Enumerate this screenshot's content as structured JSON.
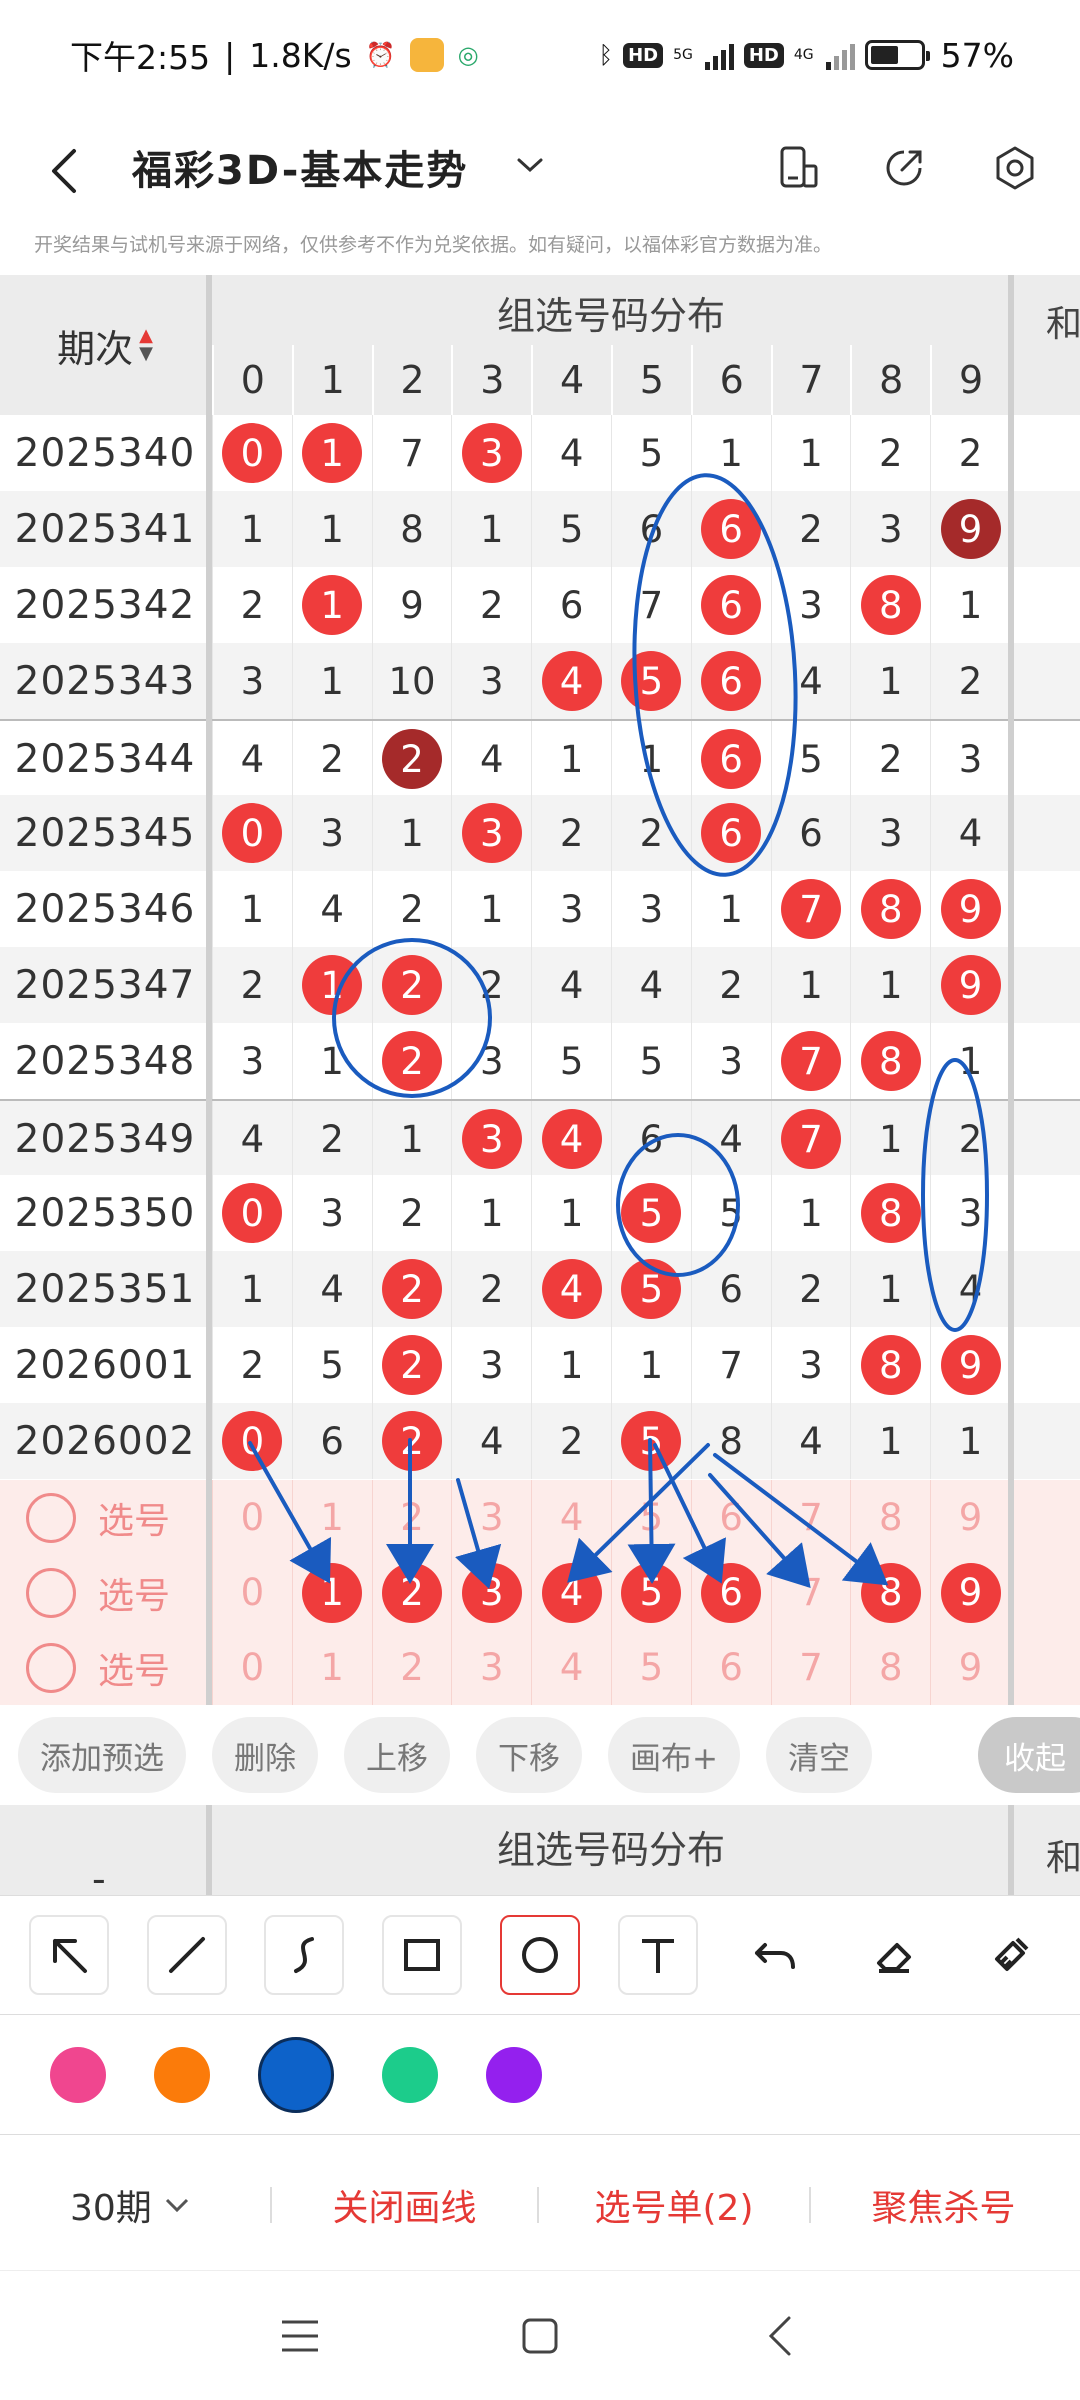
{
  "status": {
    "time": "下午2:55",
    "speed": "1.8K/s",
    "net1": "5G",
    "net2": "4G",
    "hd": "HD",
    "battery": "57%",
    "battery_level": 0.57
  },
  "header": {
    "title": "福彩3D-基本走势"
  },
  "notice": "开奖结果与试机号来源于网络，仅供参考不作为兑奖依据。如有疑问，以福体彩官方数据为准。",
  "table": {
    "period_header": "期次",
    "group_title": "组选号码分布",
    "sum_header": "和",
    "digits": [
      "0",
      "1",
      "2",
      "3",
      "4",
      "5",
      "6",
      "7",
      "8",
      "9"
    ],
    "rows": [
      {
        "period": "2025340",
        "cells": [
          {
            "v": "0",
            "b": "r"
          },
          {
            "v": "1",
            "b": "r"
          },
          {
            "v": "7"
          },
          {
            "v": "3",
            "b": "r"
          },
          {
            "v": "4"
          },
          {
            "v": "5"
          },
          {
            "v": "1"
          },
          {
            "v": "1"
          },
          {
            "v": "2"
          },
          {
            "v": "2"
          }
        ]
      },
      {
        "period": "2025341",
        "cells": [
          {
            "v": "1"
          },
          {
            "v": "1"
          },
          {
            "v": "8"
          },
          {
            "v": "1"
          },
          {
            "v": "5"
          },
          {
            "v": "6"
          },
          {
            "v": "6",
            "b": "r"
          },
          {
            "v": "2"
          },
          {
            "v": "3"
          },
          {
            "v": "9",
            "b": "d"
          }
        ]
      },
      {
        "period": "2025342",
        "cells": [
          {
            "v": "2"
          },
          {
            "v": "1",
            "b": "r"
          },
          {
            "v": "9"
          },
          {
            "v": "2"
          },
          {
            "v": "6"
          },
          {
            "v": "7"
          },
          {
            "v": "6",
            "b": "r"
          },
          {
            "v": "3"
          },
          {
            "v": "8",
            "b": "r"
          },
          {
            "v": "1"
          }
        ]
      },
      {
        "period": "2025343",
        "cells": [
          {
            "v": "3"
          },
          {
            "v": "1"
          },
          {
            "v": "10"
          },
          {
            "v": "3"
          },
          {
            "v": "4",
            "b": "r"
          },
          {
            "v": "5",
            "b": "r"
          },
          {
            "v": "6",
            "b": "r"
          },
          {
            "v": "4"
          },
          {
            "v": "1"
          },
          {
            "v": "2"
          }
        ]
      },
      {
        "period": "2025344",
        "cells": [
          {
            "v": "4"
          },
          {
            "v": "2"
          },
          {
            "v": "2",
            "b": "d"
          },
          {
            "v": "4"
          },
          {
            "v": "1"
          },
          {
            "v": "1"
          },
          {
            "v": "6",
            "b": "r"
          },
          {
            "v": "5"
          },
          {
            "v": "2"
          },
          {
            "v": "3"
          }
        ]
      },
      {
        "period": "2025345",
        "cells": [
          {
            "v": "0",
            "b": "r"
          },
          {
            "v": "3"
          },
          {
            "v": "1"
          },
          {
            "v": "3",
            "b": "r"
          },
          {
            "v": "2"
          },
          {
            "v": "2"
          },
          {
            "v": "6",
            "b": "r"
          },
          {
            "v": "6"
          },
          {
            "v": "3"
          },
          {
            "v": "4"
          }
        ]
      },
      {
        "period": "2025346",
        "cells": [
          {
            "v": "1"
          },
          {
            "v": "4"
          },
          {
            "v": "2"
          },
          {
            "v": "1"
          },
          {
            "v": "3"
          },
          {
            "v": "3"
          },
          {
            "v": "1"
          },
          {
            "v": "7",
            "b": "r"
          },
          {
            "v": "8",
            "b": "r"
          },
          {
            "v": "9",
            "b": "r"
          }
        ]
      },
      {
        "period": "2025347",
        "cells": [
          {
            "v": "2"
          },
          {
            "v": "1",
            "b": "r"
          },
          {
            "v": "2",
            "b": "r"
          },
          {
            "v": "2"
          },
          {
            "v": "4"
          },
          {
            "v": "4"
          },
          {
            "v": "2"
          },
          {
            "v": "1"
          },
          {
            "v": "1"
          },
          {
            "v": "9",
            "b": "r"
          }
        ]
      },
      {
        "period": "2025348",
        "cells": [
          {
            "v": "3"
          },
          {
            "v": "1"
          },
          {
            "v": "2",
            "b": "r"
          },
          {
            "v": "3"
          },
          {
            "v": "5"
          },
          {
            "v": "5"
          },
          {
            "v": "3"
          },
          {
            "v": "7",
            "b": "r"
          },
          {
            "v": "8",
            "b": "r"
          },
          {
            "v": "1"
          }
        ]
      },
      {
        "period": "2025349",
        "cells": [
          {
            "v": "4"
          },
          {
            "v": "2"
          },
          {
            "v": "1"
          },
          {
            "v": "3",
            "b": "r"
          },
          {
            "v": "4",
            "b": "r"
          },
          {
            "v": "6"
          },
          {
            "v": "4"
          },
          {
            "v": "7",
            "b": "r"
          },
          {
            "v": "1"
          },
          {
            "v": "2"
          }
        ]
      },
      {
        "period": "2025350",
        "cells": [
          {
            "v": "0",
            "b": "r"
          },
          {
            "v": "3"
          },
          {
            "v": "2"
          },
          {
            "v": "1"
          },
          {
            "v": "1"
          },
          {
            "v": "5",
            "b": "r"
          },
          {
            "v": "5"
          },
          {
            "v": "1"
          },
          {
            "v": "8",
            "b": "r"
          },
          {
            "v": "3"
          }
        ]
      },
      {
        "period": "2025351",
        "cells": [
          {
            "v": "1"
          },
          {
            "v": "4"
          },
          {
            "v": "2",
            "b": "r"
          },
          {
            "v": "2"
          },
          {
            "v": "4",
            "b": "r"
          },
          {
            "v": "5",
            "b": "r"
          },
          {
            "v": "6"
          },
          {
            "v": "2"
          },
          {
            "v": "1"
          },
          {
            "v": "4"
          }
        ]
      },
      {
        "period": "2026001",
        "cells": [
          {
            "v": "2"
          },
          {
            "v": "5"
          },
          {
            "v": "2",
            "b": "r"
          },
          {
            "v": "3"
          },
          {
            "v": "1"
          },
          {
            "v": "1"
          },
          {
            "v": "7"
          },
          {
            "v": "3"
          },
          {
            "v": "8",
            "b": "r"
          },
          {
            "v": "9",
            "b": "r"
          }
        ]
      },
      {
        "period": "2026002",
        "cells": [
          {
            "v": "0",
            "b": "r"
          },
          {
            "v": "6"
          },
          {
            "v": "2",
            "b": "r"
          },
          {
            "v": "4"
          },
          {
            "v": "2"
          },
          {
            "v": "5",
            "b": "r"
          },
          {
            "v": "8"
          },
          {
            "v": "4"
          },
          {
            "v": "1"
          },
          {
            "v": "1"
          }
        ]
      }
    ],
    "pick_label": "选号",
    "picks": [
      {
        "cells": [
          {
            "v": "0"
          },
          {
            "v": "1"
          },
          {
            "v": "2"
          },
          {
            "v": "3"
          },
          {
            "v": "4"
          },
          {
            "v": "5"
          },
          {
            "v": "6"
          },
          {
            "v": "7"
          },
          {
            "v": "8"
          },
          {
            "v": "9"
          }
        ]
      },
      {
        "cells": [
          {
            "v": "0"
          },
          {
            "v": "1",
            "b": "r"
          },
          {
            "v": "2",
            "b": "r"
          },
          {
            "v": "3",
            "b": "r"
          },
          {
            "v": "4",
            "b": "r"
          },
          {
            "v": "5",
            "b": "r"
          },
          {
            "v": "6",
            "b": "r"
          },
          {
            "v": "7"
          },
          {
            "v": "8",
            "b": "r"
          },
          {
            "v": "9",
            "b": "r"
          }
        ]
      },
      {
        "cells": [
          {
            "v": "0"
          },
          {
            "v": "1"
          },
          {
            "v": "2"
          },
          {
            "v": "3"
          },
          {
            "v": "4"
          },
          {
            "v": "5"
          },
          {
            "v": "6"
          },
          {
            "v": "7"
          },
          {
            "v": "8"
          },
          {
            "v": "9"
          }
        ]
      }
    ]
  },
  "actions": [
    "添加预选",
    "删除",
    "上移",
    "下移",
    "画布+",
    "清空"
  ],
  "collapse_label": "收起",
  "table2": {
    "group_title": "组选号码分布",
    "sum_header": "和",
    "dash": "-"
  },
  "tools": [
    "arrow",
    "line",
    "curve",
    "rectangle",
    "circle",
    "text",
    "undo",
    "eraser",
    "clear"
  ],
  "colors": [
    {
      "name": "pink",
      "hex": "#f0468f"
    },
    {
      "name": "orange",
      "hex": "#fb7b0a"
    },
    {
      "name": "blue",
      "hex": "#0d62c9",
      "selected": true
    },
    {
      "name": "green",
      "hex": "#1ccc8b"
    },
    {
      "name": "purple",
      "hex": "#9420ee"
    }
  ],
  "bottom": {
    "period": "30期",
    "close_lines": "关闭画线",
    "pick_list": "选号单(2)",
    "focus_kill": "聚焦杀号"
  },
  "accent": "#ef3c3c",
  "ink": "#1a5bbf"
}
